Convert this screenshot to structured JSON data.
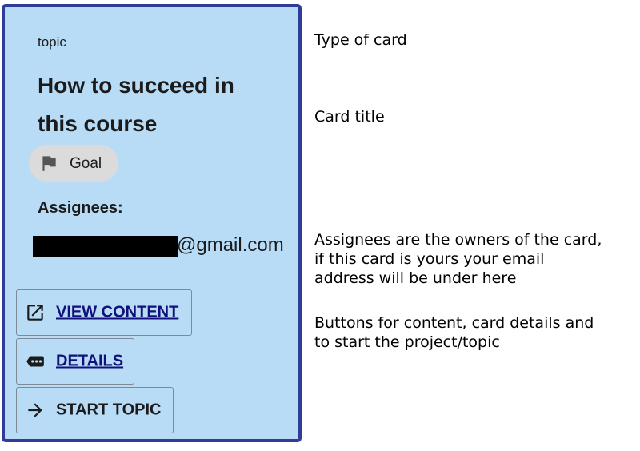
{
  "card": {
    "type": "topic",
    "title": "How to succeed in this course",
    "chip": {
      "label": "Goal",
      "icon": "flag-icon"
    },
    "assignees_label": "Assignees:",
    "email_domain": "@gmail.com",
    "buttons": {
      "view_content": {
        "label": "VIEW CONTENT",
        "icon": "open-in-new-icon"
      },
      "details": {
        "label": "DETAILS",
        "icon": "label-more-icon"
      },
      "start_topic": {
        "label": "START TOPIC",
        "icon": "arrow-right-icon"
      }
    },
    "colors": {
      "background": "#b8dcf6",
      "border": "#2f3c98",
      "link": "#12107a",
      "chip": "#dbdbdb"
    }
  },
  "annotations": {
    "type_of_card": [
      "Type of card"
    ],
    "card_title": [
      "Card title"
    ],
    "assignees": [
      "Assignees are the owners of the card,",
      "if this card is yours your email",
      "address will be under here"
    ],
    "buttons": [
      "Buttons for content, card details and",
      "to start the project/topic"
    ]
  }
}
